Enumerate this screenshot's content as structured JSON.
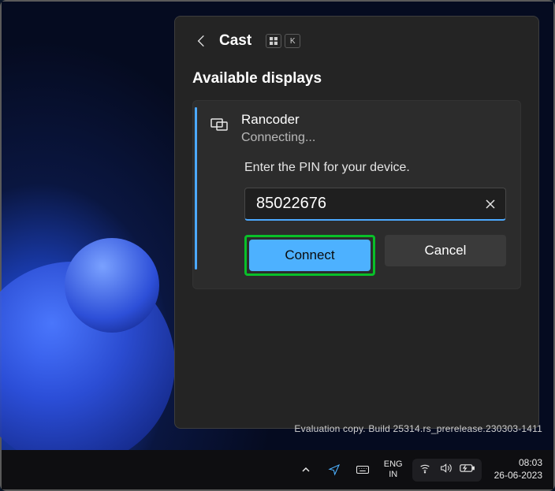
{
  "flyout": {
    "title": "Cast",
    "shortcut_key": "K",
    "section_title": "Available displays",
    "device": {
      "name": "Rancoder",
      "status": "Connecting...",
      "prompt": "Enter the PIN for your device.",
      "pin_value": "85022676"
    },
    "connect_label": "Connect",
    "cancel_label": "Cancel"
  },
  "watermark": {
    "line2": "Evaluation copy. Build 25314.rs_prerelease.230303-1411"
  },
  "taskbar": {
    "lang_top": "ENG",
    "lang_bottom": "IN",
    "time": "08:03",
    "date": "26-06-2023"
  }
}
